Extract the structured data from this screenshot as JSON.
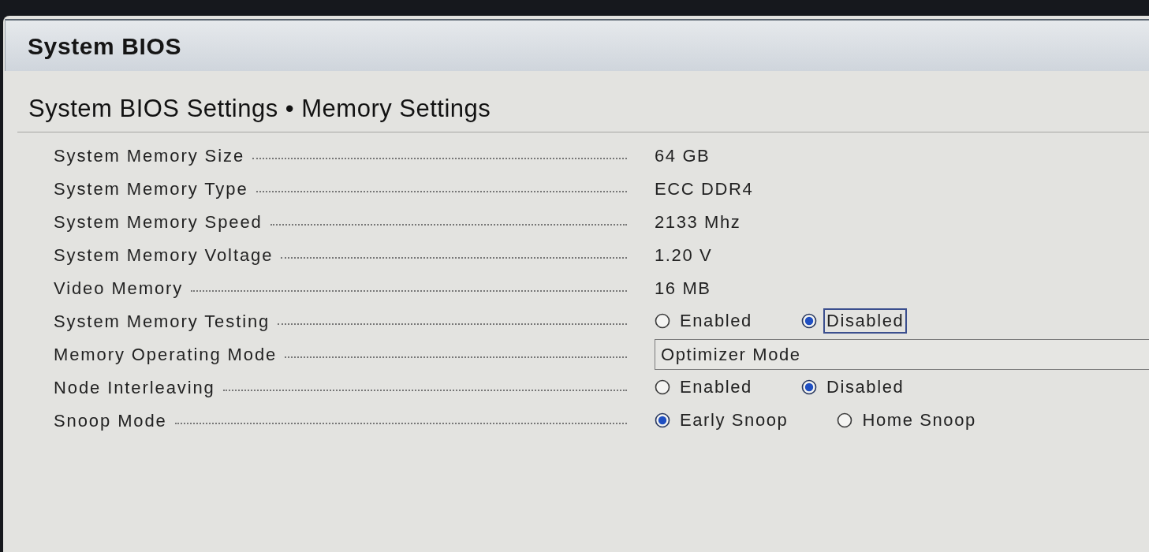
{
  "window": {
    "title": "System BIOS"
  },
  "page": {
    "title": "System BIOS Settings • Memory Settings"
  },
  "settings": [
    {
      "label": "System Memory Size",
      "kind": "text",
      "value": "64 GB"
    },
    {
      "label": "System Memory Type",
      "kind": "text",
      "value": "ECC DDR4"
    },
    {
      "label": "System Memory Speed",
      "kind": "text",
      "value": "2133 Mhz"
    },
    {
      "label": "System Memory Voltage",
      "kind": "text",
      "value": "1.20 V"
    },
    {
      "label": "Video Memory",
      "kind": "text",
      "value": "16 MB"
    },
    {
      "label": "System Memory Testing",
      "kind": "radio",
      "options": [
        {
          "label": "Enabled",
          "selected": false,
          "focused": false
        },
        {
          "label": "Disabled",
          "selected": true,
          "focused": true
        }
      ]
    },
    {
      "label": "Memory Operating Mode",
      "kind": "dropdown",
      "value": "Optimizer Mode"
    },
    {
      "label": "Node Interleaving",
      "kind": "radio",
      "options": [
        {
          "label": "Enabled",
          "selected": false,
          "focused": false
        },
        {
          "label": "Disabled",
          "selected": true,
          "focused": false
        }
      ]
    },
    {
      "label": "Snoop Mode",
      "kind": "radio",
      "options": [
        {
          "label": "Early Snoop",
          "selected": true,
          "focused": false
        },
        {
          "label": "Home Snoop",
          "selected": false,
          "focused": false
        }
      ]
    }
  ]
}
